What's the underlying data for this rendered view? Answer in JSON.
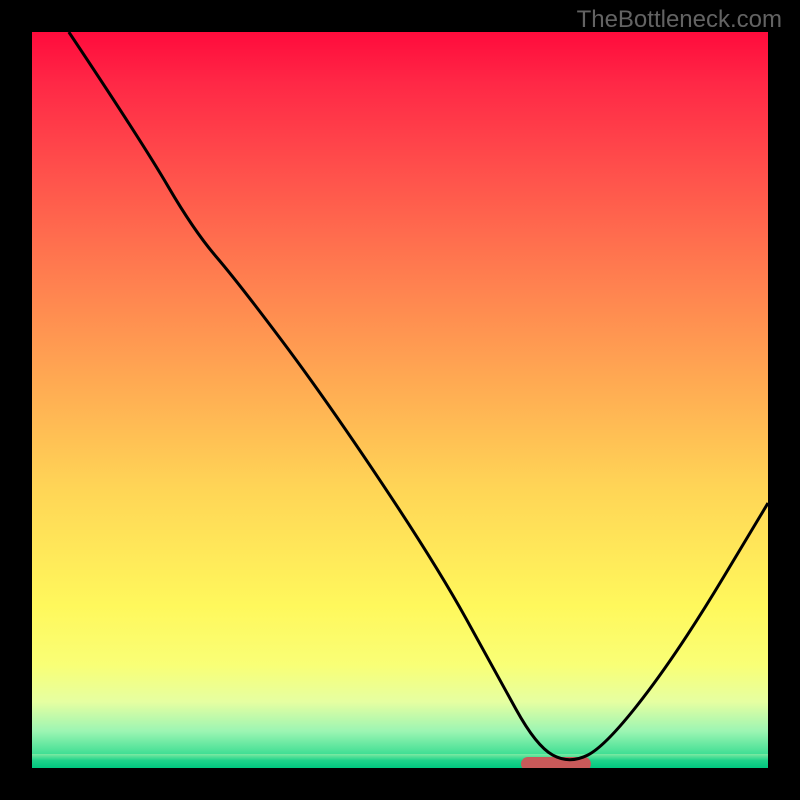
{
  "watermark": "TheBottleneck.com",
  "chart_data": {
    "type": "line",
    "title": "",
    "xlabel": "",
    "ylabel": "",
    "xlim": [
      0,
      100
    ],
    "ylim": [
      0,
      100
    ],
    "grid": false,
    "legend": false,
    "background_gradient": {
      "direction": "top-to-bottom",
      "stops": [
        {
          "pos": 0,
          "color": "#ff0b3c"
        },
        {
          "pos": 0.07,
          "color": "#ff2846"
        },
        {
          "pos": 0.18,
          "color": "#ff4d4b"
        },
        {
          "pos": 0.32,
          "color": "#ff7a4f"
        },
        {
          "pos": 0.46,
          "color": "#ffa552"
        },
        {
          "pos": 0.62,
          "color": "#ffd556"
        },
        {
          "pos": 0.78,
          "color": "#fff85c"
        },
        {
          "pos": 0.86,
          "color": "#f9ff76"
        },
        {
          "pos": 0.91,
          "color": "#e6ffa1"
        },
        {
          "pos": 0.95,
          "color": "#9cf5b3"
        },
        {
          "pos": 0.975,
          "color": "#53e39a"
        },
        {
          "pos": 1.0,
          "color": "#00d082"
        }
      ]
    },
    "series": [
      {
        "name": "bottleneck-curve",
        "color": "#000000",
        "x": [
          5.0,
          15.0,
          22.0,
          28.0,
          40.0,
          55.0,
          63.0,
          68.5,
          73.0,
          78.0,
          88.0,
          100.0
        ],
        "y": [
          100.0,
          85.0,
          73.0,
          66.0,
          50.0,
          27.5,
          13.0,
          3.0,
          0.5,
          3.0,
          16.0,
          36.0
        ]
      }
    ],
    "marker": {
      "name": "optimal-range",
      "color": "#c85a5a",
      "x_start": 66.5,
      "x_end": 76.0,
      "y": 0.5
    }
  }
}
